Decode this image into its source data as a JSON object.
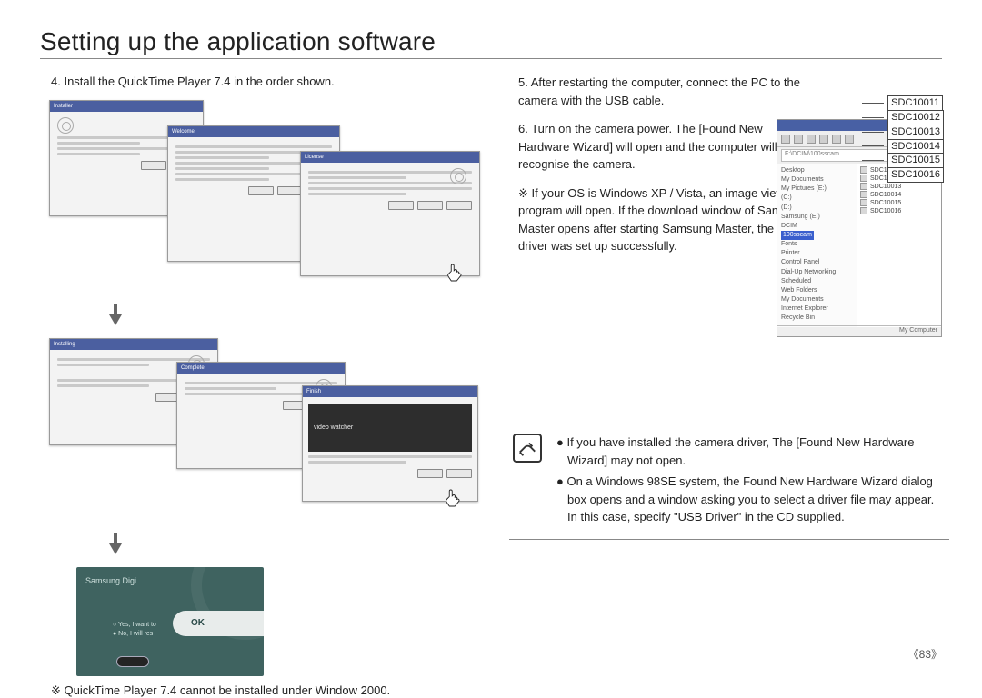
{
  "title": "Setting up the application software",
  "left": {
    "step4": "4. Install the QuickTime Player 7.4 in the order shown.",
    "footnote": "※ QuickTime Player 7.4 cannot be installed under Window 2000.",
    "complete": {
      "brand": "Samsung Digi",
      "ok": "OK"
    }
  },
  "right": {
    "step5": "5. After restarting the computer, connect the PC to the camera with the USB cable.",
    "step6": "6. Turn on the camera power. The [Found New Hardware Wizard] will open and the computer will recognise the camera.",
    "xpnote": "※ If your OS is Windows XP / Vista, an image viewer program will open. If the download window of Samsung Master opens after starting Samsung Master, the camera driver was set up successfully."
  },
  "explorer": {
    "status_left": " ",
    "status_right": "My Computer",
    "tree": [
      "Desktop",
      " My Documents",
      " My Pictures (E:)",
      " (C:)",
      " (D:)",
      "  Samsung (E:)",
      "   DCIM",
      "    100sscam",
      "  Fonts",
      "  Printer",
      "  Control Panel",
      "  Dial-Up Networking",
      "  Scheduled",
      "  Web Folders",
      "  My Documents",
      "  Internet Explorer",
      "  Recycle Bin",
      "  "
    ],
    "tree_hl": "100sscam",
    "files": [
      "SDC10011",
      "SDC10012",
      "SDC10013",
      "SDC10014",
      "SDC10015",
      "SDC10016"
    ],
    "callouts": [
      "SDC10011",
      "SDC10012",
      "SDC10013",
      "SDC10014",
      "SDC10015",
      "SDC10016"
    ]
  },
  "info": {
    "b1": "● If you have installed the camera driver, The [Found New Hardware Wizard] may not open.",
    "b2": "● On a Windows 98SE system, the Found New Hardware Wizard dialog box opens and a window asking you to select a driver file may appear. In this case, specify \"USB Driver\" in the CD supplied."
  },
  "pagenum": "《83》"
}
